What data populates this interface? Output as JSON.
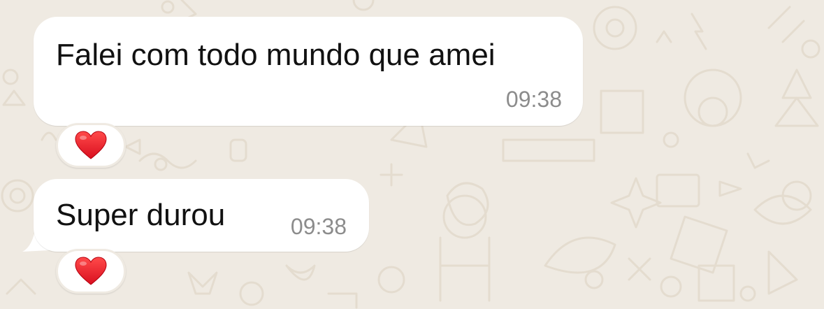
{
  "chat": {
    "background_color": "#efeae2",
    "bubble_color": "#ffffff",
    "messages": [
      {
        "text": "Falei com todo mundo que amei",
        "time": "09:38",
        "reaction": "red-heart-icon"
      },
      {
        "text": "Super durou",
        "time": "09:38",
        "reaction": "red-heart-icon"
      }
    ]
  }
}
